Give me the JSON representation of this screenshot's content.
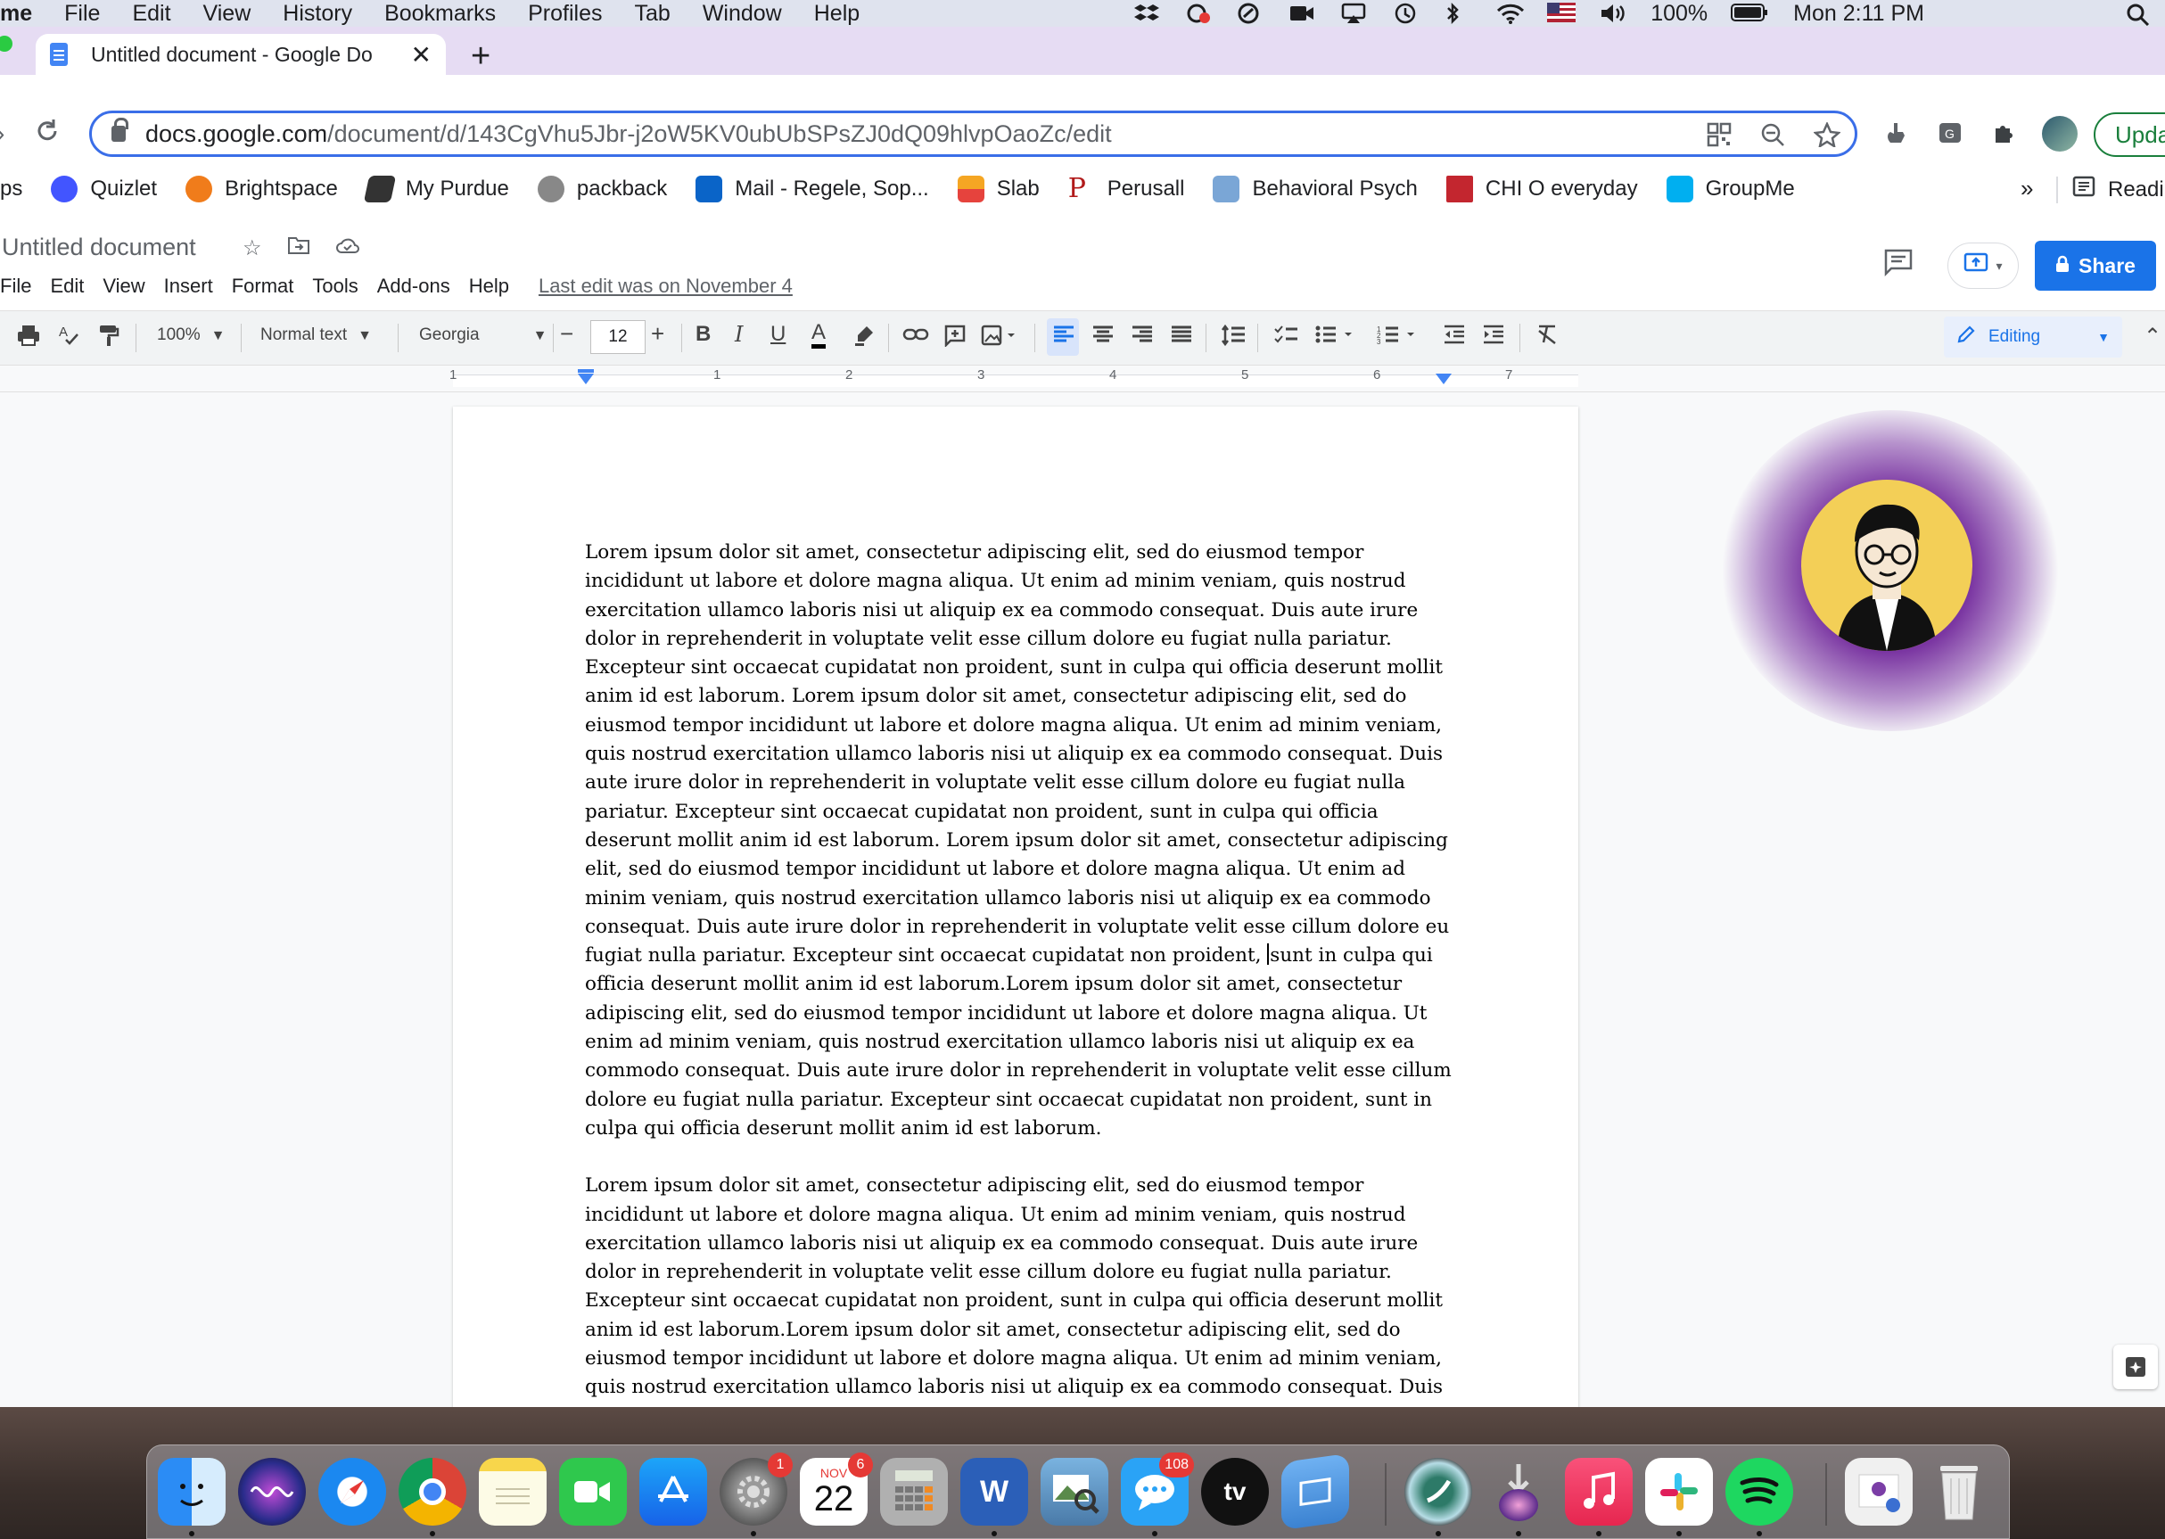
{
  "menubar": {
    "app": "me",
    "items": [
      "File",
      "Edit",
      "View",
      "History",
      "Bookmarks",
      "Profiles",
      "Tab",
      "Window",
      "Help"
    ],
    "battery": "100%",
    "clock": "Mon 2:11 PM"
  },
  "browser": {
    "tab_title": "Untitled document - Google Do",
    "url_host": "docs.google.com",
    "url_path": "/document/d/143CgVhu5Jbr-j2oW5KV0ubUbSPsZJ0dQ09hlvpOaoZc/edit",
    "update_label": "Upda"
  },
  "bookmarks": {
    "items": [
      {
        "label": "ps",
        "color": "#ffffff"
      },
      {
        "label": "Quizlet",
        "color": "#4255ff"
      },
      {
        "label": "Brightspace",
        "color": "#f07c1b"
      },
      {
        "label": "My Purdue",
        "color": "#333333"
      },
      {
        "label": "packback",
        "color": "#888888"
      },
      {
        "label": "Mail - Regele, Sop...",
        "color": "#0a64c8"
      },
      {
        "label": "Slab",
        "color": "#e6433d"
      },
      {
        "label": "Perusall",
        "color": "#b11b1b"
      },
      {
        "label": "Behavioral Psych",
        "color": "#7aa6d6"
      },
      {
        "label": "CHI O everyday",
        "color": "#c3262f"
      },
      {
        "label": "GroupMe",
        "color": "#00aff0"
      }
    ],
    "more": "»",
    "reading": "Readi"
  },
  "docs": {
    "title": "Untitled document",
    "menu": [
      "File",
      "Edit",
      "View",
      "Insert",
      "Format",
      "Tools",
      "Add-ons",
      "Help"
    ],
    "last_edit": "Last edit was on November 4",
    "share_label": "Share",
    "toolbar": {
      "zoom": "100%",
      "style": "Normal text",
      "font": "Georgia",
      "size": "12",
      "mode": "Editing"
    },
    "ruler_numbers": [
      "1",
      "1",
      "1",
      "2",
      "3",
      "4",
      "5",
      "6",
      "7"
    ]
  },
  "document": {
    "para1_a": "Lorem ipsum dolor sit amet, consectetur adipiscing elit, sed do eiusmod tempor incididunt ut labore et dolore magna aliqua. Ut enim ad minim veniam, quis nostrud exercitation ullamco laboris nisi ut aliquip ex ea commodo consequat. Duis aute irure dolor in reprehenderit in voluptate velit esse cillum dolore eu fugiat nulla pariatur. Excepteur sint occaecat cupidatat non proident, sunt in culpa qui officia deserunt mollit anim id est laborum. Lorem ipsum dolor sit amet, consectetur adipiscing elit, sed do eiusmod tempor incididunt ut labore et dolore magna aliqua. Ut enim ad minim veniam, quis nostrud exercitation ullamco laboris nisi ut aliquip ex ea commodo consequat. Duis aute irure dolor in reprehenderit in voluptate velit esse cillum dolore eu fugiat nulla pariatur. Excepteur sint occaecat cupidatat non proident, sunt in culpa qui officia deserunt mollit anim id est laborum. Lorem ipsum dolor sit amet, consectetur adipiscing elit, sed do eiusmod tempor incididunt ut labore et dolore magna aliqua. Ut enim ad minim veniam, quis nostrud exercitation ullamco laboris nisi ut aliquip ex ea commodo consequat. Duis aute irure dolor in reprehenderit in voluptate velit esse cillum dolore eu fugiat nulla pariatur. Excepteur sint occaecat cupidatat non proident,",
    "para1_b": "sunt in culpa qui officia deserunt mollit anim id est laborum.Lorem ipsum dolor sit amet, consectetur adipiscing elit, sed do eiusmod tempor incididunt ut labore et dolore magna aliqua. Ut enim ad minim veniam, quis nostrud exercitation ullamco laboris nisi ut aliquip ex ea commodo consequat. Duis aute irure dolor in reprehenderit in voluptate velit esse cillum dolore eu fugiat nulla pariatur. Excepteur sint occaecat cupidatat non proident, sunt in culpa qui officia deserunt mollit anim id est laborum.",
    "para2": "Lorem ipsum dolor sit amet, consectetur adipiscing elit, sed do eiusmod tempor incididunt ut labore et dolore magna aliqua. Ut enim ad minim veniam, quis nostrud exercitation ullamco laboris nisi ut aliquip ex ea commodo consequat. Duis aute irure dolor in reprehenderit in voluptate velit esse cillum dolore eu fugiat nulla pariatur. Excepteur sint occaecat cupidatat non proident, sunt in culpa qui officia deserunt mollit anim id est laborum.Lorem ipsum dolor sit amet, consectetur adipiscing elit, sed do eiusmod tempor incididunt ut labore et dolore magna aliqua. Ut enim ad minim veniam, quis nostrud exercitation ullamco laboris nisi ut aliquip ex ea commodo consequat. Duis"
  },
  "dock": {
    "settings_badge": "1",
    "calendar_month": "NOV",
    "calendar_day": "22",
    "calendar_badge": "6",
    "messages_badge": "108",
    "tv_label": "tv"
  }
}
